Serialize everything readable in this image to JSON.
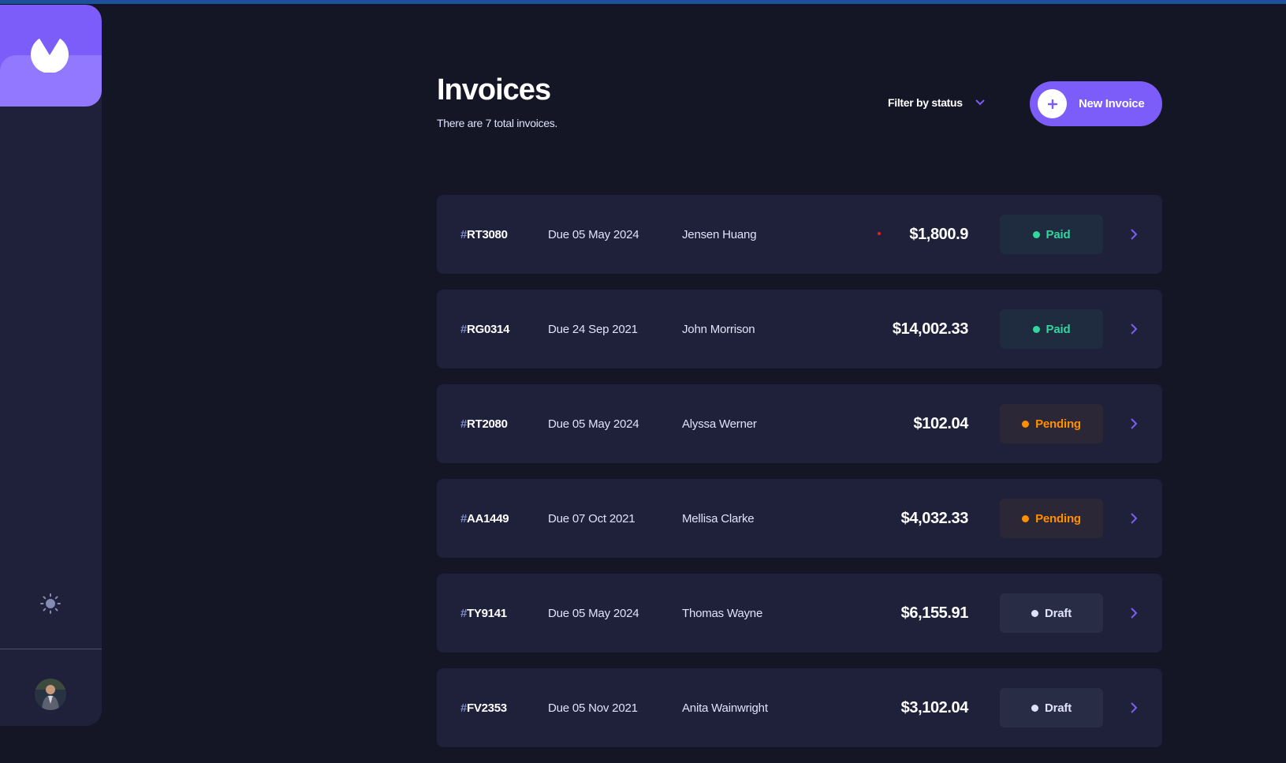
{
  "colors": {
    "accent": "#7c5dfa",
    "paid": "#33d69f",
    "pending": "#ff8f00",
    "draft": "#dfe3fa"
  },
  "sidebar": {
    "logo_icon": "logo-icon",
    "theme_icon": "sun-icon",
    "avatar_icon": "user-avatar"
  },
  "header": {
    "title": "Invoices",
    "subtitle": "There are 7 total invoices.",
    "filter_label": "Filter by status",
    "new_invoice_label": "New Invoice"
  },
  "invoices": [
    {
      "hash": "#",
      "id": "RT3080",
      "due": "Due 05 May 2024",
      "client": "Jensen Huang",
      "amount": "$1,800.9",
      "status": "Paid"
    },
    {
      "hash": "#",
      "id": "RG0314",
      "due": "Due 24 Sep 2021",
      "client": "John Morrison",
      "amount": "$14,002.33",
      "status": "Paid"
    },
    {
      "hash": "#",
      "id": "RT2080",
      "due": "Due 05 May 2024",
      "client": "Alyssa Werner",
      "amount": "$102.04",
      "status": "Pending"
    },
    {
      "hash": "#",
      "id": "AA1449",
      "due": "Due 07 Oct 2021",
      "client": "Mellisa Clarke",
      "amount": "$4,032.33",
      "status": "Pending"
    },
    {
      "hash": "#",
      "id": "TY9141",
      "due": "Due 05 May 2024",
      "client": "Thomas Wayne",
      "amount": "$6,155.91",
      "status": "Draft"
    },
    {
      "hash": "#",
      "id": "FV2353",
      "due": "Due 05 Nov 2021",
      "client": "Anita Wainwright",
      "amount": "$3,102.04",
      "status": "Draft"
    }
  ]
}
